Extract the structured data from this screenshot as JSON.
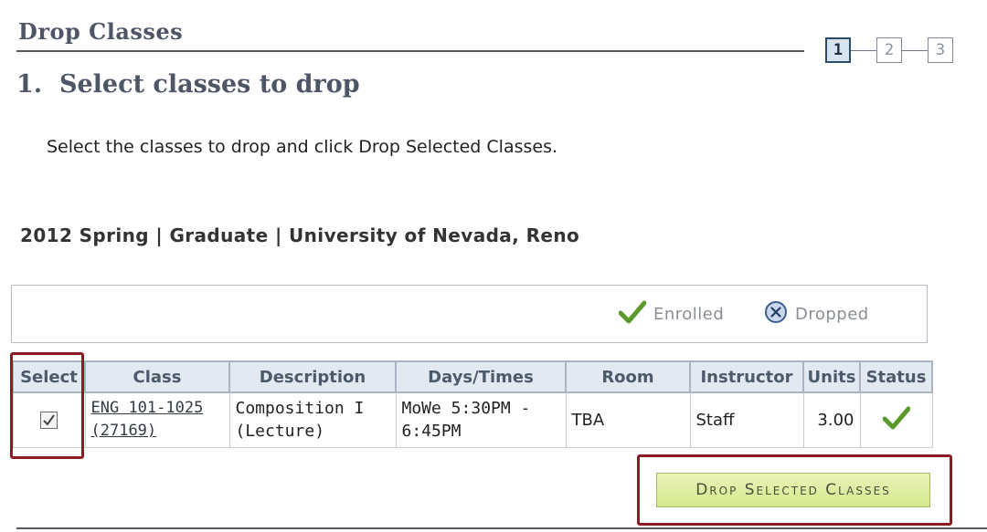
{
  "header": {
    "title": "Drop Classes"
  },
  "steps": [
    {
      "label": "1",
      "active": true
    },
    {
      "label": "2"
    },
    {
      "label": "3"
    }
  ],
  "section": {
    "heading": "1.  Select classes to drop",
    "instructions": "Select the classes to drop and click Drop Selected Classes."
  },
  "term": {
    "heading": "2012 Spring | Graduate | University of Nevada, Reno"
  },
  "legend": {
    "enrolled": "Enrolled",
    "dropped": "Dropped",
    "enrolled_icon": "check-icon",
    "dropped_icon": "x-circle-icon"
  },
  "table": {
    "headers": [
      "Select",
      "Class",
      "Description",
      "Days/Times",
      "Room",
      "Instructor",
      "Units",
      "Status"
    ],
    "rows": [
      {
        "selected": true,
        "class_line1": "ENG 101-1025",
        "class_line2": "(27169)",
        "description_line1": "Composition I",
        "description_line2": "(Lecture)",
        "days_line1": "MoWe 5:30PM -",
        "days_line2": "6:45PM",
        "room": "TBA",
        "instructor": "Staff",
        "units": "3.00",
        "status_icon": "check-icon"
      }
    ]
  },
  "actions": {
    "drop_label": "Drop Selected Classes"
  },
  "colors": {
    "accent_green": "#5a9a2a",
    "highlight_red": "#8b1c22",
    "header_bg": "#e3e9f0",
    "button_bg": "#dcec9c"
  }
}
